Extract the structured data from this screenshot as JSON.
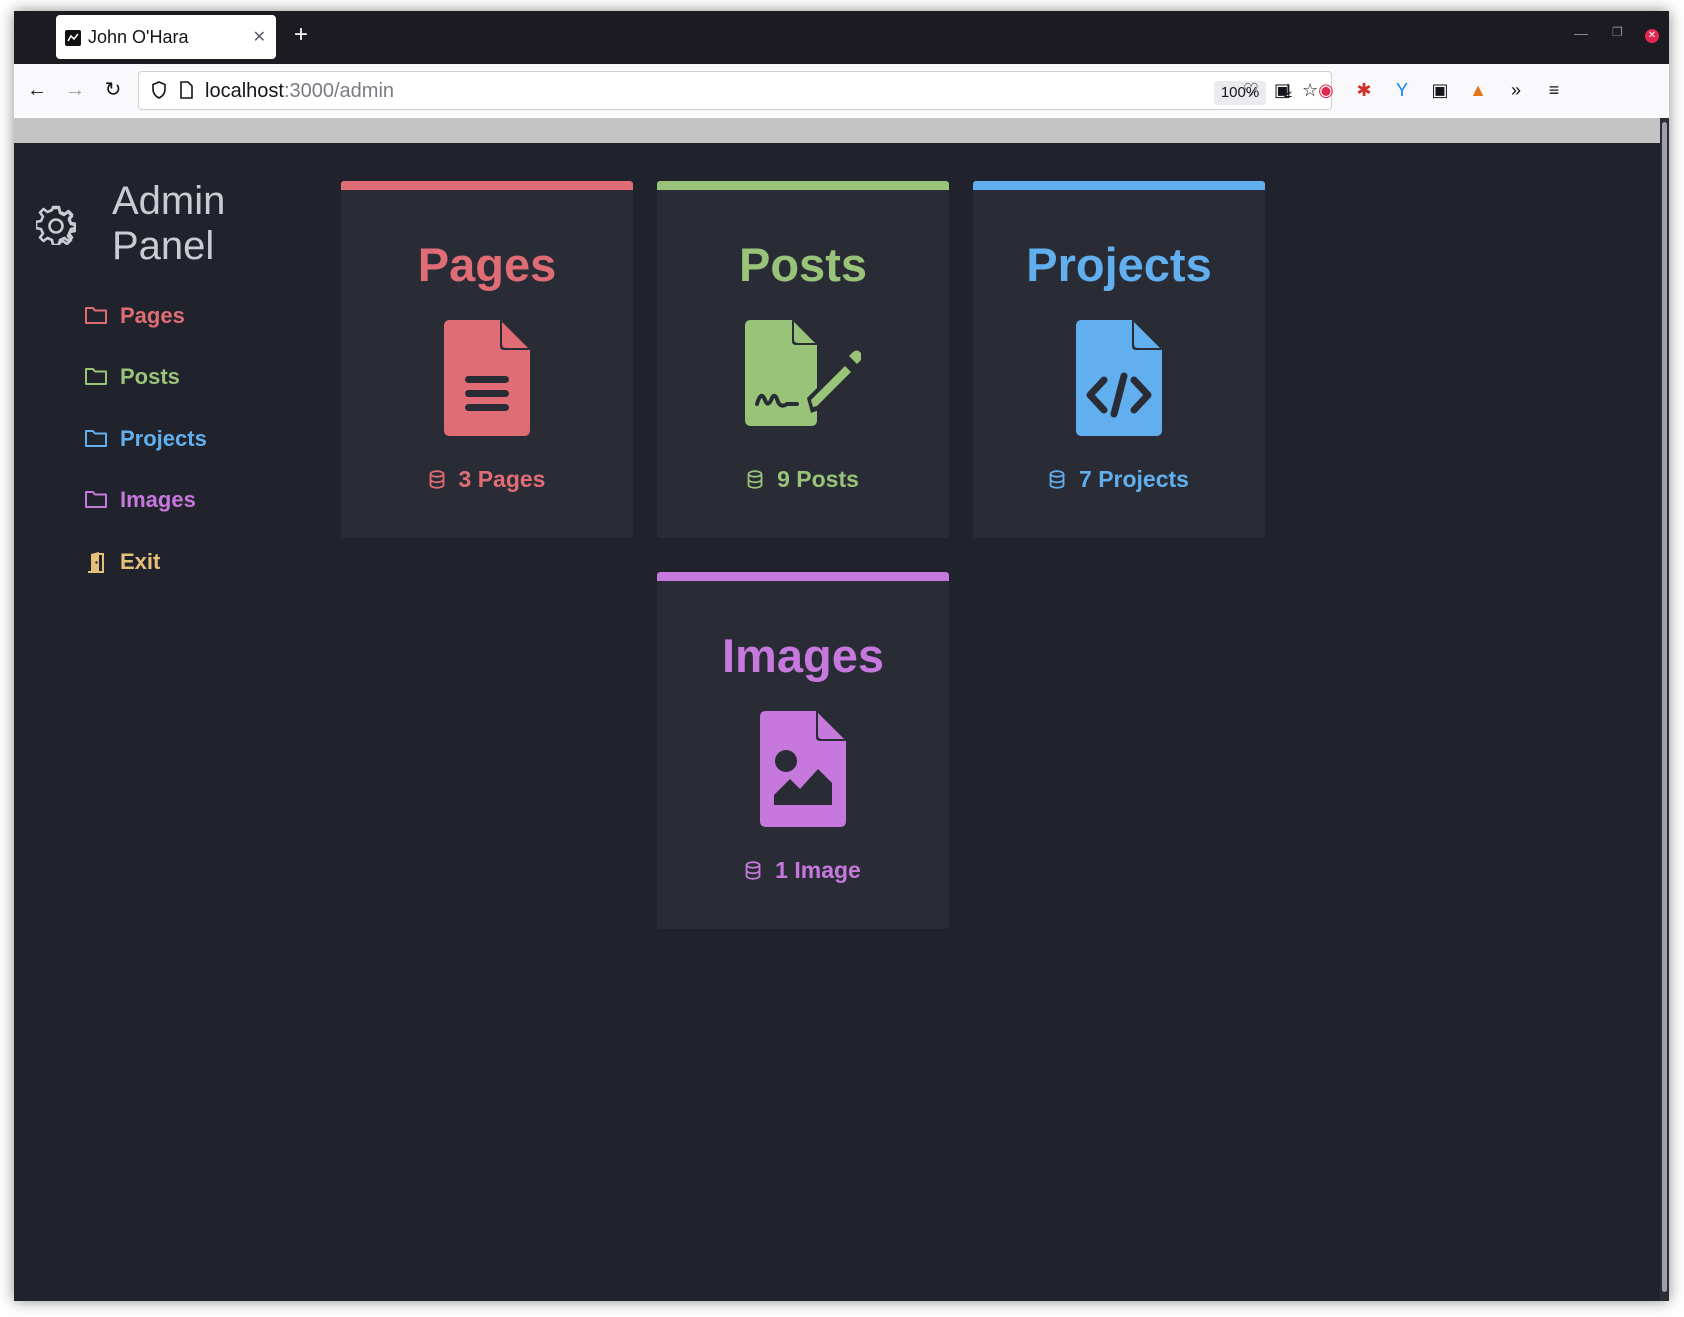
{
  "browser": {
    "tab_title": "John O'Hara",
    "url_host": "localhost",
    "url_path": ":3000/admin",
    "zoom": "100%"
  },
  "sidebar": {
    "brand_line1": "Admin",
    "brand_line2": "Panel",
    "items": [
      {
        "label": "Pages",
        "icon": "folder-icon",
        "color": "#e06c75"
      },
      {
        "label": "Posts",
        "icon": "folder-icon",
        "color": "#98c379"
      },
      {
        "label": "Projects",
        "icon": "folder-icon",
        "color": "#61afef"
      },
      {
        "label": "Images",
        "icon": "folder-icon",
        "color": "#c678dd"
      },
      {
        "label": "Exit",
        "icon": "door-exit-icon",
        "color": "#e5c07b"
      }
    ]
  },
  "cards": [
    {
      "title": "Pages",
      "count": "3 Pages",
      "icon": "file-lines-icon",
      "color": "#e06c75"
    },
    {
      "title": "Posts",
      "count": "9 Posts",
      "icon": "file-signature-icon",
      "color": "#98c379"
    },
    {
      "title": "Projects",
      "count": "7 Projects",
      "icon": "file-code-icon",
      "color": "#61afef"
    },
    {
      "title": "Images",
      "count": "1 Image",
      "icon": "file-image-icon",
      "color": "#c678dd"
    }
  ]
}
